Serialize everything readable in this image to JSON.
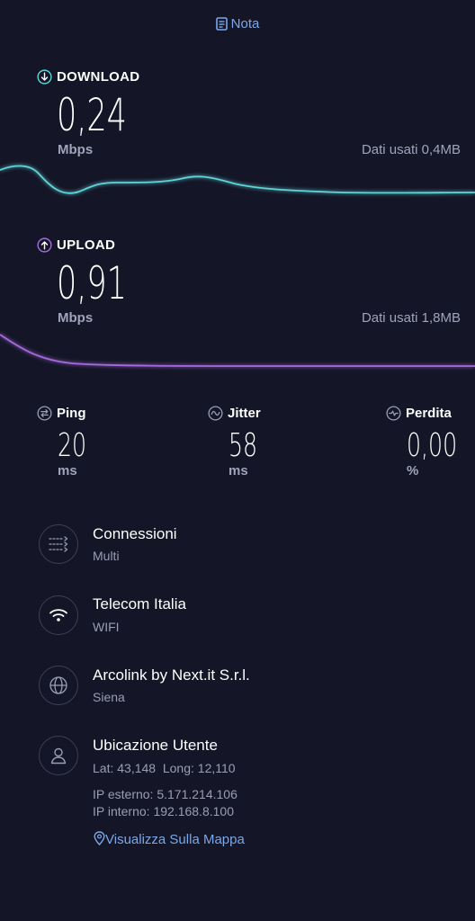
{
  "header": {
    "nota_label": "Nota"
  },
  "download": {
    "title": "DOWNLOAD",
    "value": "0,24",
    "unit": "Mbps",
    "data_used": "Dati usati 0,4MB",
    "color": "#5fd4d6"
  },
  "upload": {
    "title": "UPLOAD",
    "value": "0,91",
    "unit": "Mbps",
    "data_used": "Dati usati 1,8MB",
    "color": "#a76bdf"
  },
  "stats": {
    "ping": {
      "label": "Ping",
      "value": "20",
      "unit": "ms"
    },
    "jitter": {
      "label": "Jitter",
      "value": "58",
      "unit": "ms"
    },
    "loss": {
      "label": "Perdita",
      "value": "0,00",
      "unit": "%"
    }
  },
  "info": {
    "connections": {
      "title": "Connessioni",
      "sub": "Multi",
      "icon": "connections-icon"
    },
    "network": {
      "title": "Telecom Italia",
      "sub": "WIFI",
      "icon": "wifi-icon"
    },
    "server": {
      "title": "Arcolink by Next.it S.r.l.",
      "sub": "Siena",
      "icon": "globe-icon"
    },
    "location": {
      "title": "Ubicazione Utente",
      "lat_label": "Lat:",
      "lat": "43,148",
      "long_label": "Long:",
      "long": "12,110",
      "ip_ext": "IP esterno: 5.171.214.106",
      "ip_int": "IP interno: 192.168.8.100",
      "map_link": "Visualizza Sulla Mappa",
      "icon": "user-icon"
    }
  },
  "colors": {
    "background": "#141526",
    "accent_blue": "#7aa8ea",
    "muted": "#a0a4bb"
  }
}
